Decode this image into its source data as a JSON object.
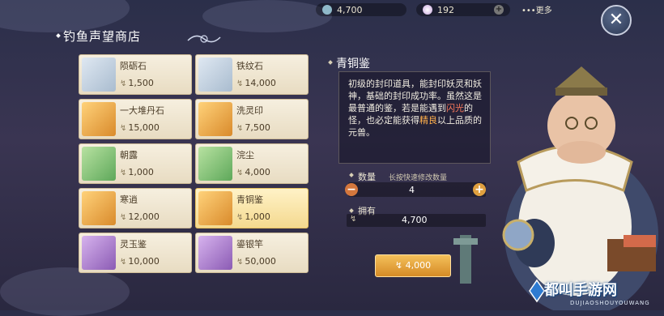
{
  "currency": {
    "coin_amount": "4,700",
    "gem_amount": "192",
    "more_label": "更多"
  },
  "shop": {
    "title": "钓鱼声望商店"
  },
  "items": [
    {
      "name": "陨砺石",
      "price": "1,500",
      "rarity": "silver"
    },
    {
      "name": "铁纹石",
      "price": "14,000",
      "rarity": "silver"
    },
    {
      "name": "一大堆丹石",
      "price": "15,000",
      "rarity": "orange"
    },
    {
      "name": "洗灵印",
      "price": "7,500",
      "rarity": "orange"
    },
    {
      "name": "朝露",
      "price": "1,000",
      "rarity": "green"
    },
    {
      "name": "浣尘",
      "price": "4,000",
      "rarity": "green"
    },
    {
      "name": "寒逍",
      "price": "12,000",
      "rarity": "orange"
    },
    {
      "name": "青铜鉴",
      "price": "1,000",
      "rarity": "orange"
    },
    {
      "name": "灵玉鉴",
      "price": "10,000",
      "rarity": "purple"
    },
    {
      "name": "鎏银竿",
      "price": "50,000",
      "rarity": "purple"
    }
  ],
  "detail": {
    "title": "青铜鉴",
    "desc_1": "初级的封印道具，能封印妖灵和妖神，基础的封印成功率。虽然这是最普通的鉴，若是能遇到",
    "desc_highlight_red": "闪光",
    "desc_2": "的怪，也必定能获得",
    "desc_highlight_orange": "精良",
    "desc_3": "以上品质的元兽。",
    "quantity_label": "数量",
    "quantity_hint": "长按快速修改数量",
    "quantity": "4",
    "owned_label": "拥有",
    "owned": "4,700",
    "buy_price": "4,000"
  },
  "branding": {
    "logo": "都叫手游网",
    "logo_sub": "DUJIAOSHOUYOUWANG"
  },
  "colors": {
    "selected_item": "#f4d98f",
    "buy_button": "#d58b26",
    "highlight_red": "#ff7b5c",
    "highlight_orange": "#ffb04c"
  },
  "icons": {
    "coin": "fishing-coin-icon",
    "gem": "pearl-icon",
    "close": "close-icon"
  }
}
